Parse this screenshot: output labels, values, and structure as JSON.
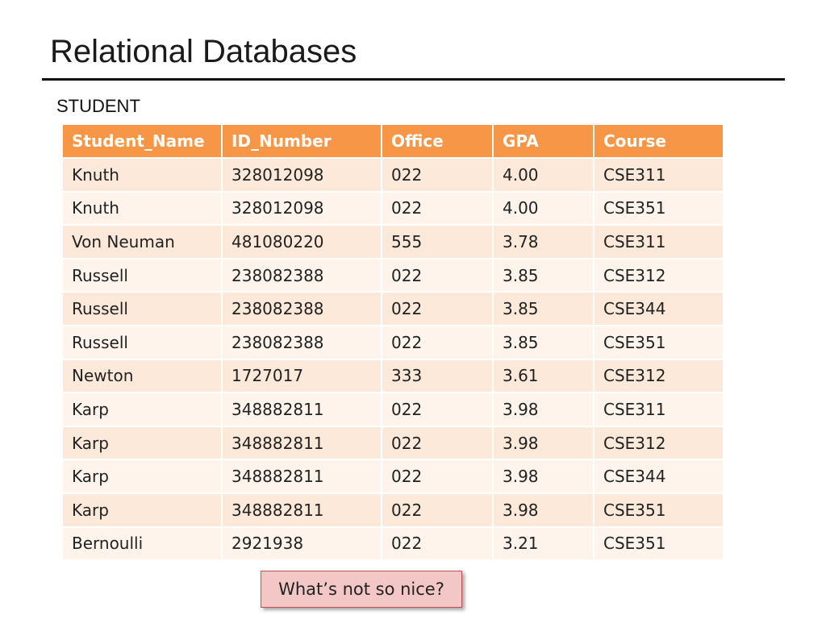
{
  "slide": {
    "title": "Relational Databases",
    "table_label": "STUDENT",
    "callout": "What’s not so nice?"
  },
  "table": {
    "headers": [
      "Student_Name",
      "ID_Number",
      "Office",
      "GPA",
      "Course"
    ],
    "rows": [
      [
        "Knuth",
        "328012098",
        "022",
        "4.00",
        "CSE311"
      ],
      [
        "Knuth",
        "328012098",
        "022",
        "4.00",
        "CSE351"
      ],
      [
        "Von Neuman",
        "481080220",
        "555",
        "3.78",
        "CSE311"
      ],
      [
        "Russell",
        "238082388",
        "022",
        "3.85",
        "CSE312"
      ],
      [
        "Russell",
        "238082388",
        "022",
        "3.85",
        "CSE344"
      ],
      [
        "Russell",
        "238082388",
        "022",
        "3.85",
        "CSE351"
      ],
      [
        "Newton",
        "1727017",
        "333",
        "3.61",
        "CSE312"
      ],
      [
        "Karp",
        "348882811",
        "022",
        "3.98",
        "CSE311"
      ],
      [
        "Karp",
        "348882811",
        "022",
        "3.98",
        "CSE312"
      ],
      [
        "Karp",
        "348882811",
        "022",
        "3.98",
        "CSE344"
      ],
      [
        "Karp",
        "348882811",
        "022",
        "3.98",
        "CSE351"
      ],
      [
        "Bernoulli",
        "2921938",
        "022",
        "3.21",
        "CSE351"
      ]
    ]
  },
  "colors": {
    "header_bg": "#f79646",
    "row_odd_bg": "#fde9d9",
    "row_even_bg": "#fef4ec",
    "callout_bg": "#f4c7c7",
    "callout_border": "#c0504d"
  }
}
